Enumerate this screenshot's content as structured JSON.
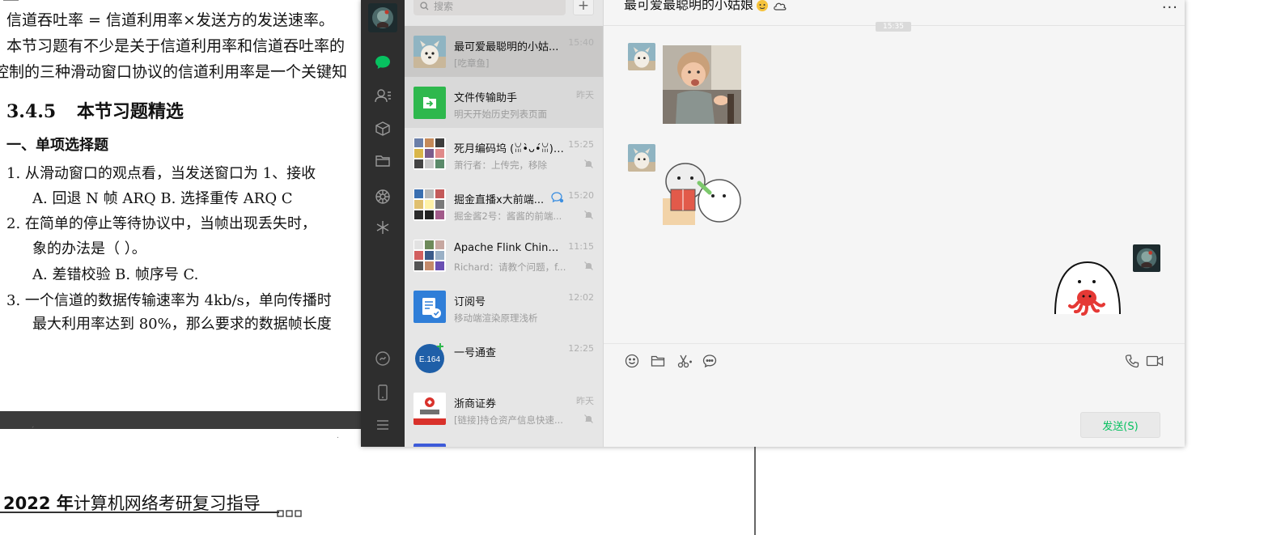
{
  "document": {
    "lines": [
      "信道吞吐率 = 信道利用率×发送方的发送速率。",
      "本节习题有不少是关于信道利用率和信道吞吐率的",
      "控制的三种滑动窗口协议的信道利用率是一个关键知"
    ],
    "section_number": "3.4.5",
    "section_title": "本节习题精选",
    "subsection": "一、单项选择题",
    "q1": "1.  从滑动窗口的观点看，当发送窗口为 1、接收",
    "q1_options": "A.  回退 N 帧 ARQ      B.  选择重传 ARQ    C",
    "q2": "2.  在简单的停止等待协议中，当帧出现丢失时，",
    "q2_cont": "象的办法是（  ）。",
    "q2_options": "A.  差错校验          B.  帧序号               C.",
    "q3": "3.  一个信道的数据传输速率为 4kb/s，单向传播时",
    "q3_cont": "最大利用率达到 80%，那么要求的数据帧长度",
    "footer_bold": "2022 年",
    "footer_rest": "计算机网络考研复习指导"
  },
  "wechat": {
    "search_placeholder": "搜索",
    "add_label": "+",
    "conversations": [
      {
        "name": "最可爱最聪明的小姑...",
        "time": "15:40",
        "preview": "[吃章鱼]",
        "muted": false,
        "avatar": "dog-avatar"
      },
      {
        "name": "文件传输助手",
        "time": "昨天",
        "preview": "明天开始历史列表页面",
        "muted": false,
        "avatar": "file-transfer-avatar"
      },
      {
        "name": "死月编码坞 (ꈍ•̀ᴗ•́ꈍ) ...",
        "time": "15:25",
        "preview": "萧行者：上传完，移除",
        "muted": true,
        "avatar": "group-avatar"
      },
      {
        "name": "掘金直播x大前端...",
        "time": "15:20",
        "preview": "掘金酱2号：酱酱的前端...",
        "muted": true,
        "avatar": "group-avatar"
      },
      {
        "name": "Apache Flink China...",
        "time": "11:15",
        "preview": "Richard：请教个问题，f...",
        "muted": true,
        "avatar": "group-avatar"
      },
      {
        "name": "订阅号",
        "time": "12:02",
        "preview": "移动端渲染原理浅析",
        "muted": false,
        "avatar": "subscription-avatar"
      },
      {
        "name": "一号通查",
        "time": "12:25",
        "preview": "",
        "muted": false,
        "avatar": "e164-avatar"
      },
      {
        "name": "浙商证券",
        "time": "昨天",
        "preview": "[链接]持仓资产信息快速...",
        "muted": true,
        "avatar": "zheshang-avatar"
      }
    ],
    "chat": {
      "title": "最可爱最聪明的小姑娘",
      "more": "...",
      "time_pill": "15:35",
      "e164_text": "E.164",
      "send_label": "发送(S)"
    }
  },
  "colors": {
    "wechat_green": "#07c160",
    "nav_bg": "#2e2e2e",
    "list_bg": "#e6e6e6",
    "active_item": "#c9c8c7"
  }
}
